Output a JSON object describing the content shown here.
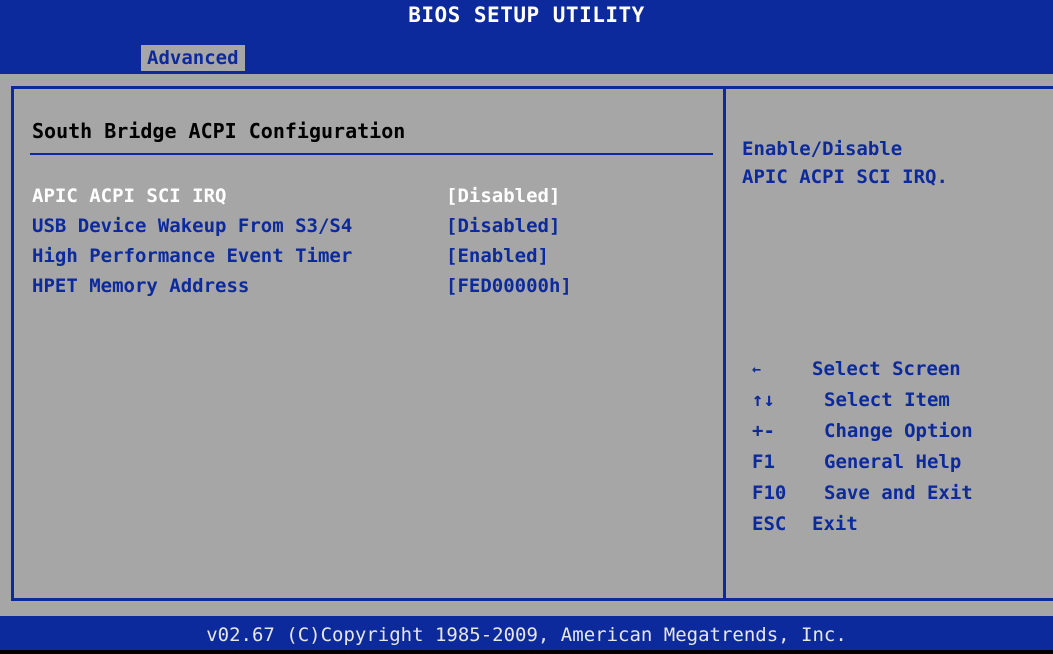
{
  "window": {
    "title": "BIOS SETUP UTILITY"
  },
  "tabs": [
    {
      "label": "Advanced",
      "active": true
    }
  ],
  "section": {
    "title": "South Bridge ACPI Configuration"
  },
  "settings": [
    {
      "label": "APIC ACPI SCI IRQ",
      "value": "[Disabled]",
      "selected": true
    },
    {
      "label": "USB Device Wakeup From S3/S4",
      "value": "[Disabled]",
      "selected": false
    },
    {
      "label": "High Performance Event Timer",
      "value": "[Enabled]",
      "selected": false
    },
    {
      "label": "HPET Memory Address",
      "value": "[FED00000h]",
      "selected": false
    }
  ],
  "help": {
    "line1": "Enable/Disable",
    "line2": "APIC ACPI SCI IRQ."
  },
  "keys": [
    {
      "key": "←",
      "desc": "Select Screen"
    },
    {
      "key": "↑↓",
      "desc": "Select Item"
    },
    {
      "key": "+-",
      "desc": "Change Option"
    },
    {
      "key": "F1",
      "desc": "General Help"
    },
    {
      "key": "F10",
      "desc": "Save and Exit"
    },
    {
      "key": "ESC",
      "desc": "Exit"
    }
  ],
  "footer": {
    "text": "v02.67 (C)Copyright 1985-2009, American Megatrends, Inc."
  },
  "colors": {
    "header_blue": "#0c2a9c",
    "panel_gray": "#a6a6a6",
    "selected_text": "#ffffff",
    "normal_text": "#0c2a9c"
  }
}
